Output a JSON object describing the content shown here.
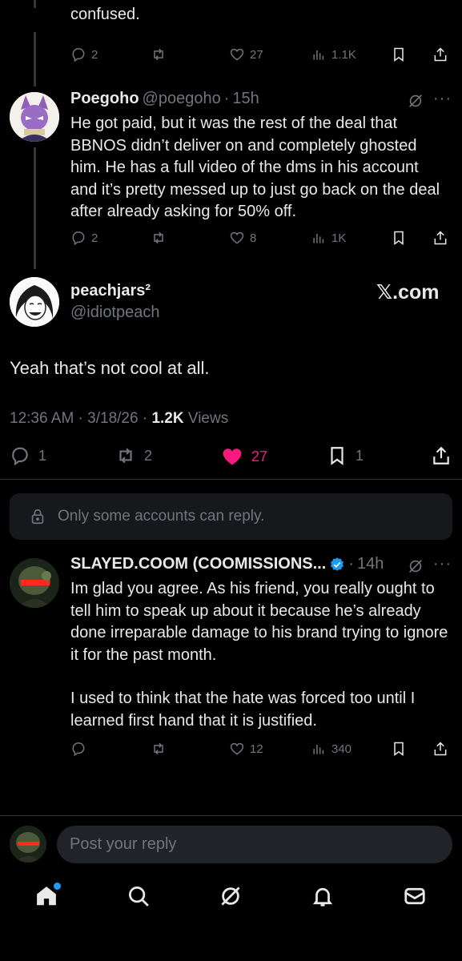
{
  "top_reply": {
    "text_tail": "confused.",
    "replies": "2",
    "likes": "27",
    "views": "1.1K"
  },
  "reply_poegoho": {
    "name": "Poegoho",
    "handle": "@poegoho",
    "time": "15h",
    "text": "He got paid, but it was the rest of the deal that BBNOS didn’t deliver on and completely ghosted him. He has a full video of the dms in his account and it’s pretty messed up to just go back on the deal after already asking for 50% off.",
    "replies": "2",
    "likes": "8",
    "views": "1K"
  },
  "main_post": {
    "name": "peachjars²",
    "handle": "@idiotpeach",
    "brand": "𝕏.com",
    "text": "Yeah that’s not cool at all.",
    "time": "12:36 AM · 3/18/26 ·",
    "views_count": "1.2K",
    "views_label": "Views",
    "replies": "1",
    "reposts": "2",
    "likes": "27",
    "bookmarks": "1",
    "like_color": "#f91880"
  },
  "reply_restriction": {
    "text": "Only some accounts can reply."
  },
  "reply_slayed": {
    "name": "SLAYED.COOM (COOMISSIONS...",
    "time": "14h",
    "text_p1": "Im glad you agree. As his friend, you really ought to tell him to speak up about it because he’s already done irreparable damage to his brand trying to ignore it for the past month.",
    "text_p2": "I used to think that the hate was forced too until I learned first hand that it is justified.",
    "likes": "12",
    "views": "340",
    "verified_color": "#1d9bf0"
  },
  "composer": {
    "placeholder": "Post your reply"
  },
  "bottom_nav": {
    "items": [
      "home-icon",
      "search-icon",
      "grok-icon",
      "notifications-icon",
      "messages-icon"
    ],
    "notification_dot_color": "#1d9bf0"
  }
}
